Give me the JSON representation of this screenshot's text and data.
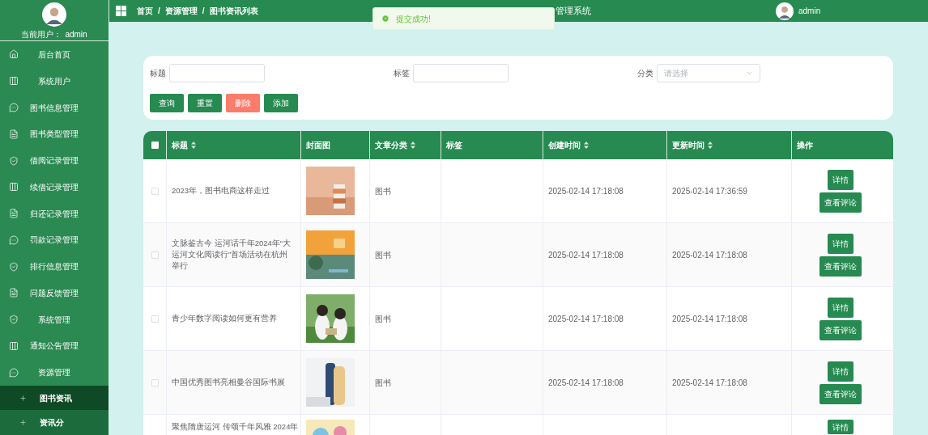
{
  "sidebar": {
    "user_label": "当前用户：",
    "user_name": "admin",
    "items": [
      {
        "label": "后台首页",
        "selected": false
      },
      {
        "label": "系统用户",
        "selected": false
      },
      {
        "label": "图书信息管理",
        "selected": false
      },
      {
        "label": "图书类型管理",
        "selected": false
      },
      {
        "label": "借阅记录管理",
        "selected": false
      },
      {
        "label": "续借记录管理",
        "selected": false
      },
      {
        "label": "归还记录管理",
        "selected": false
      },
      {
        "label": "罚款记录管理",
        "selected": false
      },
      {
        "label": "排行信息管理",
        "selected": false
      },
      {
        "label": "问题反馈管理",
        "selected": false
      },
      {
        "label": "系统管理",
        "selected": false
      },
      {
        "label": "通知公告管理",
        "selected": false
      },
      {
        "label": "资源管理",
        "expanded": true,
        "selected": false,
        "children": [
          {
            "label": "图书资讯",
            "selected": true
          },
          {
            "label": "资讯分",
            "selected": false
          }
        ]
      }
    ]
  },
  "header": {
    "breadcrumb": [
      "首页",
      "资源管理",
      "图书资讯列表"
    ],
    "separator": "/",
    "title": "管理系统",
    "user_name": "admin"
  },
  "toast": {
    "message": "提交成功!"
  },
  "filters": {
    "fields": [
      {
        "label": "标题",
        "kind": "input"
      },
      {
        "label": "标签",
        "kind": "input"
      },
      {
        "label": "分类",
        "kind": "select",
        "placeholder": "请选择"
      }
    ],
    "buttons": [
      {
        "label": "查询",
        "kind": "primary"
      },
      {
        "label": "重置",
        "kind": "primary"
      },
      {
        "label": "删除",
        "kind": "danger"
      },
      {
        "label": "添加",
        "kind": "primary"
      }
    ]
  },
  "table": {
    "select_all_checked": false,
    "columns": [
      {
        "label": "标题",
        "sortable": true
      },
      {
        "label": "封面图",
        "sortable": false
      },
      {
        "label": "文章分类",
        "sortable": true
      },
      {
        "label": "标签",
        "sortable": false
      },
      {
        "label": "创建时间",
        "sortable": true
      },
      {
        "label": "更新时间",
        "sortable": true
      },
      {
        "label": "操作",
        "sortable": false
      }
    ],
    "rows": [
      {
        "checked": false,
        "title": "2023年，图书电商这样走过",
        "category": "图书",
        "created": "2025-02-14 17:18:08",
        "updated": "2025-02-14 17:36:59",
        "actions": [
          "详情",
          "查看评论"
        ]
      },
      {
        "checked": false,
        "title": "文脉鉴古今 运河话千年2024年“大运河文化阅读行”首场活动在杭州举行",
        "category": "图书",
        "created": "2025-02-14 17:18:08",
        "updated": "2025-02-14 17:18:08",
        "actions": [
          "详情",
          "查看评论"
        ]
      },
      {
        "checked": false,
        "title": "青少年数字阅读如何更有营养",
        "category": "图书",
        "created": "2025-02-14 17:18:08",
        "updated": "2025-02-14 17:18:08",
        "actions": [
          "详情",
          "查看评论"
        ]
      },
      {
        "checked": false,
        "title": "中国优秀图书亮相曼谷国际书展",
        "category": "图书",
        "created": "2025-02-14 17:18:08",
        "updated": "2025-02-14 17:18:08",
        "actions": [
          "详情",
          "查看评论"
        ]
      },
      {
        "title": "聚焦隋唐运河 传颂千年风雅 2024年",
        "actions": [
          "详情"
        ]
      }
    ]
  }
}
